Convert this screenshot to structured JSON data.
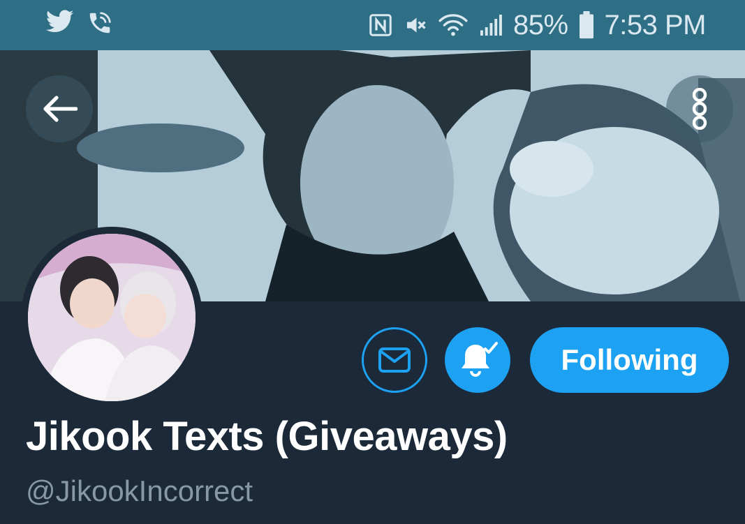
{
  "status_bar": {
    "battery_percent": "85%",
    "time": "7:53 PM",
    "left_icons": [
      "twitter-bird-icon",
      "wifi-call-icon"
    ],
    "right_icons": [
      "nfc-icon",
      "mute-icon",
      "wifi-icon",
      "signal-icon",
      "battery-icon"
    ]
  },
  "header": {
    "back_icon": "arrow-left-icon",
    "more_icon": "more-vertical-icon"
  },
  "profile": {
    "display_name": "Jikook Texts (Giveaways)",
    "handle": "@JikookIncorrect",
    "actions": {
      "message_icon": "envelope-icon",
      "notifications_icon": "bell-check-icon",
      "following_label": "Following"
    }
  },
  "colors": {
    "status_bar_bg": "#2f6f86",
    "profile_bg": "#1c2938",
    "accent": "#1da1f2",
    "display_name": "#ffffff",
    "handle": "#8899a6"
  }
}
